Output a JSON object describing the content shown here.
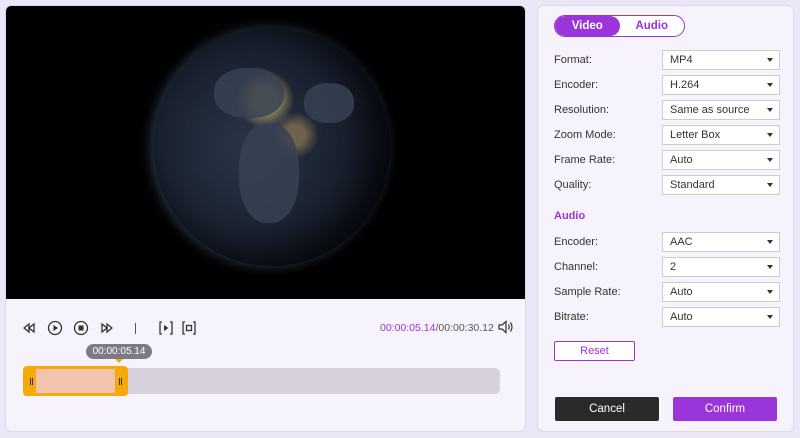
{
  "player": {
    "current_time": "00:00:05.14",
    "total_time": "/00:00:30.12",
    "tooltip_time": "00:00:05.14",
    "trim_selection_end_fraction": 0.22
  },
  "tabs": [
    {
      "label": "Video",
      "active": true
    },
    {
      "label": "Audio",
      "active": false
    }
  ],
  "video_settings": [
    {
      "label": "Format:",
      "value": "MP4"
    },
    {
      "label": "Encoder:",
      "value": "H.264"
    },
    {
      "label": "Resolution:",
      "value": "Same as source"
    },
    {
      "label": "Zoom Mode:",
      "value": "Letter Box"
    },
    {
      "label": "Frame Rate:",
      "value": "Auto"
    },
    {
      "label": "Quality:",
      "value": "Standard"
    }
  ],
  "audio_section_title": "Audio",
  "audio_settings": [
    {
      "label": "Encoder:",
      "value": "AAC"
    },
    {
      "label": "Channel:",
      "value": "2"
    },
    {
      "label": "Sample Rate:",
      "value": "Auto"
    },
    {
      "label": "Bitrate:",
      "value": "Auto"
    }
  ],
  "buttons": {
    "reset": "Reset",
    "cancel": "Cancel",
    "confirm": "Confirm"
  },
  "colors": {
    "accent": "#9a35d9",
    "trim": "#f5a90a"
  }
}
